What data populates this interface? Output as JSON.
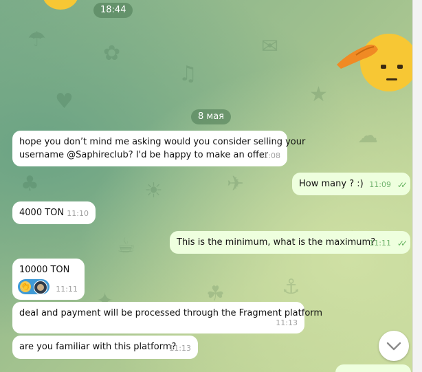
{
  "date_pills": {
    "top_time": "18:44",
    "date": "8 мая"
  },
  "messages": [
    {
      "dir": "in",
      "text_line1": "hope you don’t mind me asking would you consider selling your",
      "text_line2": "username @Saphireclub? I'd be happy to make an offer",
      "time": "11:08"
    },
    {
      "dir": "out",
      "text": "How many ? :)",
      "time": "11:09",
      "ticks": "✓✓"
    },
    {
      "dir": "in",
      "text": "4000 TON",
      "time": "11:10"
    },
    {
      "dir": "out",
      "text": "This is the minimum, what is the maximum?",
      "time": "11:11",
      "ticks": "✓✓"
    },
    {
      "dir": "in",
      "text": "10000 TON",
      "time": "11:11",
      "reactions": [
        "clapping-hands-emoji",
        "user-avatar"
      ]
    },
    {
      "dir": "in",
      "text": "deal and payment will be processed through the Fragment platform",
      "time": "11:13"
    },
    {
      "dir": "in",
      "text": "are you familiar with this platform?",
      "time": "11:13"
    }
  ],
  "icons": {
    "scroll_down": "chevron-down-icon",
    "salute": "saluting-face-emoji"
  },
  "colors": {
    "incoming": "#ffffff",
    "outgoing": "#eeffde",
    "pill": "#4a7852",
    "ticks": "#5fb05a"
  }
}
